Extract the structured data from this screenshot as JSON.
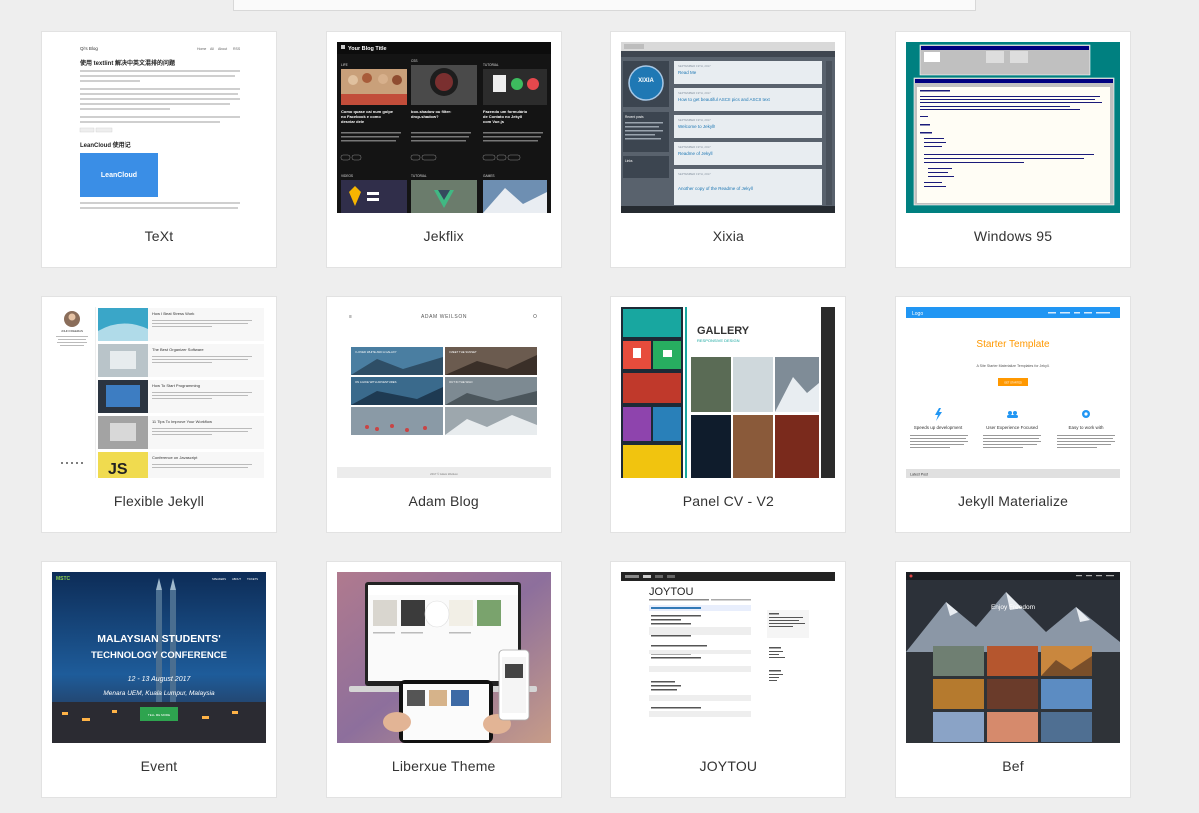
{
  "themes": [
    {
      "name": "TeXt"
    },
    {
      "name": "Jekflix"
    },
    {
      "name": "Xixia"
    },
    {
      "name": "Windows 95"
    },
    {
      "name": "Flexible Jekyll"
    },
    {
      "name": "Adam Blog"
    },
    {
      "name": "Panel CV - V2"
    },
    {
      "name": "Jekyll Materialize"
    },
    {
      "name": "Event"
    },
    {
      "name": "Liberxue Theme"
    },
    {
      "name": "JOYTOU"
    },
    {
      "name": "Bef"
    }
  ],
  "previews": {
    "text": {
      "site": "Qi's Blog",
      "heading": "使用 textlint 解决中英文混排的问题",
      "heading2": "LeanCloud 使用记",
      "banner": "LeanCloud",
      "nav": [
        "Home",
        "All",
        "About",
        "RSS"
      ]
    },
    "jekflix": {
      "site": "Your Blog Title",
      "cats": [
        "LIFE",
        "CSS",
        "TUTORIAL",
        "VIDEOS",
        "TUTORIAL",
        "GAMES"
      ],
      "titles": [
        "Como quase caí num golpe no Facebook e como desviar dele",
        "box-shadow ou filter: drop-shadow?",
        "Fazendo um formulário de Contato no Jekyll com Vue.js"
      ]
    },
    "xixia": {
      "logo": "XIXIA",
      "posts": [
        "Read Me",
        "How to get beautiful ASCII pics and ASCII text",
        "Welcome to Jekyll!",
        "Readme of Jekyll",
        "Another copy of the Readme of Jekyll"
      ],
      "dates": [
        "SEPTEMBER 19TH, 2017",
        "SEPTEMBER 19TH, 2017",
        "SEPTEMBER 19TH, 2017",
        "SEPTEMBER 19TH, 2017",
        "SEPTEMBER 19TH, 2017"
      ],
      "side": [
        "Recent posts",
        "Links"
      ]
    },
    "flexible": {
      "author": "JOHN FREEMAN",
      "posts": [
        "How I Beat Stress Work",
        "The Best Organizer Software",
        "How To Start Programming",
        "11 Tips To Improve Your Workflow",
        "Conference on Javascript"
      ]
    },
    "adam": {
      "site": "ADAM WEILSON",
      "tiles": [
        "I LOVED WHITE AND A GALAXY",
        "I MEET THE SUNSET",
        "ON A HIKE WITH ADVENTURES",
        "OUT IN THE WILD"
      ],
      "footer": "2017 © Adam Weilson"
    },
    "panel": {
      "title": "GALLERY",
      "subtitle": "RESPONSIVE DESIGN"
    },
    "materialize": {
      "logo": "Logo",
      "title": "Starter Template",
      "sub": "A Site Starter Materialize Templates for Jekyll.",
      "button": "GET STARTED",
      "features": [
        "Speeds up development",
        "User Experience Focused",
        "Easy to work with"
      ],
      "footer": "Latest Post"
    },
    "event": {
      "logo": "MSTC",
      "nav": [
        "SPEAKERS",
        "ABOUT",
        "TICKETS"
      ],
      "title1": "MALAYSIAN STUDENTS'",
      "title2": "TECHNOLOGY CONFERENCE",
      "date": "12 - 13 August 2017",
      "venue": "Menara UEM, Kuala Lumpur, Malaysia",
      "button": "TELL ME MORE"
    },
    "joytou": {
      "title": "JOYTOU"
    },
    "bef": {
      "title": "Enjoy Freedom"
    }
  }
}
